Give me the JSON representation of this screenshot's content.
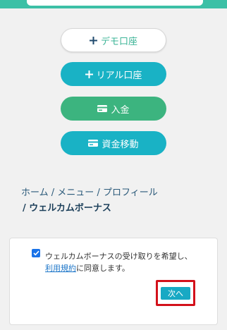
{
  "buttons": {
    "demo_account": "デモ口座",
    "real_account": "リアル口座",
    "deposit": "入金",
    "fund_transfer": "資金移動"
  },
  "icons": {
    "demo_account": "plus-icon",
    "real_account": "plus-icon",
    "deposit": "card-icon",
    "fund_transfer": "card-icon"
  },
  "breadcrumb": {
    "home": "ホーム",
    "menu": "メニュー",
    "profile": "プロフィール",
    "current": "ウェルカムボーナス",
    "separator": "/"
  },
  "consent": {
    "checked": true,
    "text_part1": "ウェルカムボーナスの受け取りを希望し、",
    "terms_link": "利用規約",
    "text_part2": "に同意します。"
  },
  "next_button": "次へ",
  "colors": {
    "teal": "#19b2c5",
    "green": "#3cb47f",
    "highlight": "#d3111b",
    "link": "#1f77c9"
  }
}
